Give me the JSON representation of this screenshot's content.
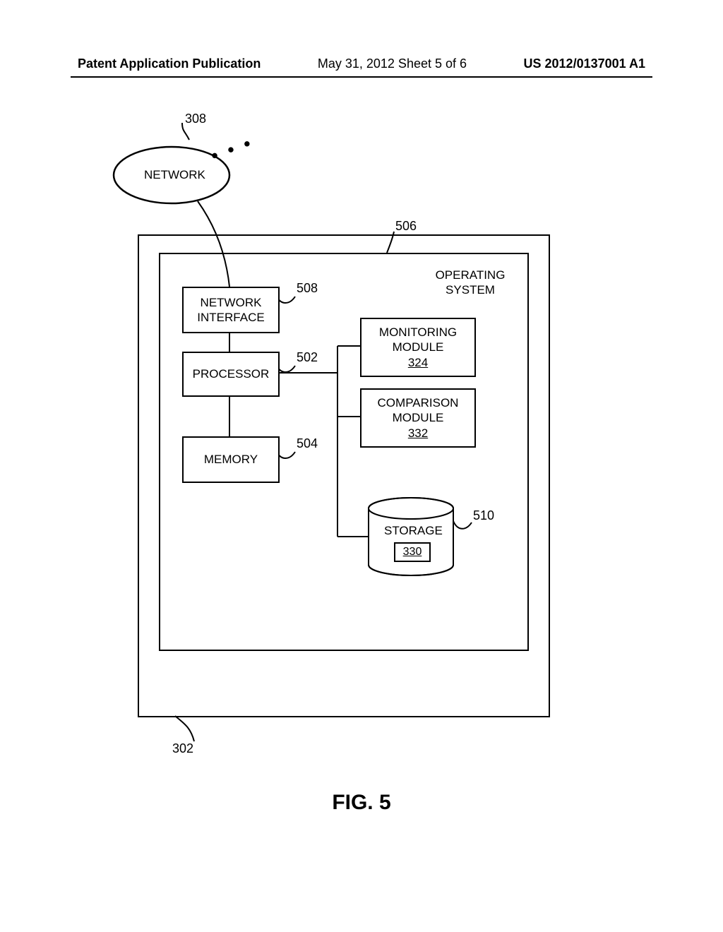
{
  "header": {
    "left": "Patent Application Publication",
    "mid": "May 31, 2012  Sheet 5 of 6",
    "right": "US 2012/0137001 A1"
  },
  "network": {
    "label": "NETWORK",
    "ref": "308"
  },
  "outer_ref": "302",
  "inner_ref": "506",
  "blocks": {
    "netiface": {
      "line1": "NETWORK",
      "line2": "INTERFACE",
      "ref": "508"
    },
    "processor": {
      "label": "PROCESSOR",
      "ref": "502"
    },
    "memory": {
      "label": "MEMORY",
      "ref": "504"
    },
    "os": {
      "line1": "OPERATING",
      "line2": "SYSTEM"
    },
    "monitoring": {
      "line1": "MONITORING",
      "line2": "MODULE",
      "ref": "324"
    },
    "comparison": {
      "line1": "COMPARISON",
      "line2": "MODULE",
      "ref": "332"
    },
    "storage": {
      "label": "STORAGE",
      "ref": "510",
      "innerref": "330"
    }
  },
  "figure": "FIG. 5"
}
